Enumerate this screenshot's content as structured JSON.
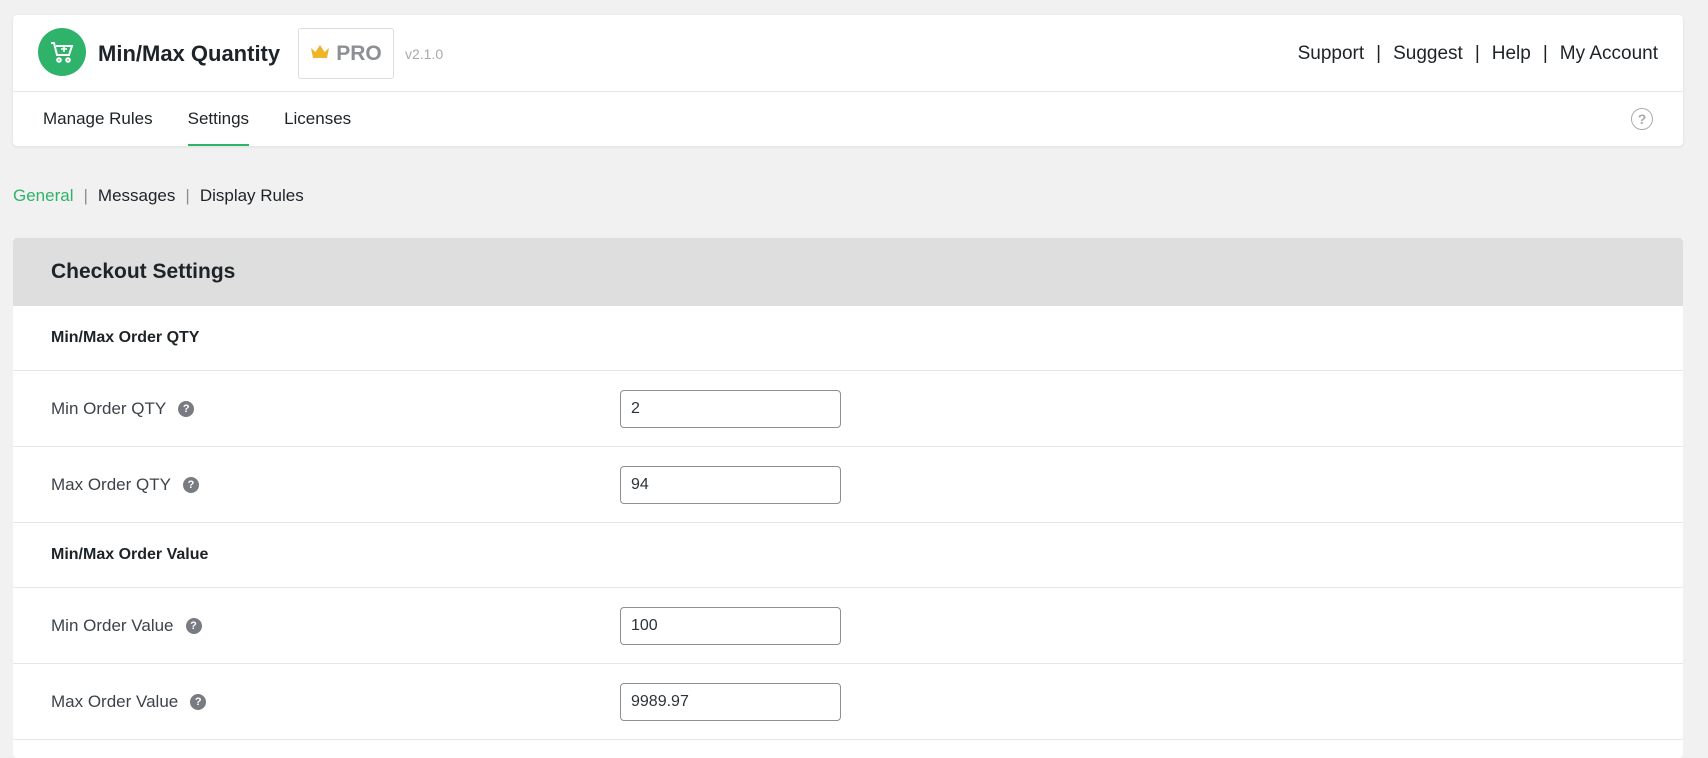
{
  "app": {
    "title": "Min/Max Quantity",
    "badge": "PRO",
    "version": "v2.1.0",
    "brand_color": "#2fb36b"
  },
  "top_links": [
    {
      "label": "Support"
    },
    {
      "label": "Suggest"
    },
    {
      "label": "Help"
    },
    {
      "label": "My Account"
    }
  ],
  "separator": "|",
  "tabs": [
    {
      "label": "Manage Rules",
      "active": false
    },
    {
      "label": "Settings",
      "active": true
    },
    {
      "label": "Licenses",
      "active": false
    }
  ],
  "subnav": [
    {
      "label": "General",
      "active": true
    },
    {
      "label": "Messages",
      "active": false
    },
    {
      "label": "Display Rules",
      "active": false
    }
  ],
  "panel": {
    "title": "Checkout Settings",
    "sections": [
      {
        "title": "Min/Max Order QTY",
        "fields": [
          {
            "label": "Min Order QTY",
            "value": "2"
          },
          {
            "label": "Max Order QTY",
            "value": "94"
          }
        ]
      },
      {
        "title": "Min/Max Order Value",
        "fields": [
          {
            "label": "Min Order Value",
            "value": "100"
          },
          {
            "label": "Max Order Value",
            "value": "9989.97"
          }
        ]
      }
    ]
  },
  "icons": {
    "logo": "cart-icon",
    "badge": "crown-icon",
    "help": "question-circle-icon",
    "field_help": "question-icon"
  }
}
